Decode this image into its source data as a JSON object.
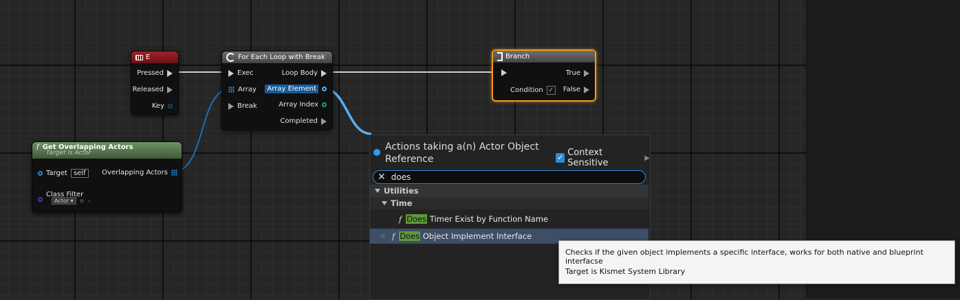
{
  "colors": {
    "graph_bg": "#262626",
    "event_header": "#a3202a",
    "function_header": "#6f9364",
    "selection_outline": "#f29b1d",
    "object_pin": "#2a8cd8",
    "search_highlight": "#5e9a3a"
  },
  "event_node": {
    "title": "E",
    "icon": "keyboard-icon",
    "pins": {
      "pressed": "Pressed",
      "released": "Released",
      "key": "Key"
    }
  },
  "foreach_node": {
    "title": "For Each Loop with Break",
    "icon": "loop-icon",
    "pins": {
      "exec": "Exec",
      "array": "Array",
      "break": "Break",
      "loop_body": "Loop Body",
      "array_element": "Array Element",
      "array_index": "Array Index",
      "completed": "Completed"
    }
  },
  "branch_node": {
    "title": "Branch",
    "icon": "branch-icon",
    "pins": {
      "true": "True",
      "condition": "Condition",
      "false": "False"
    }
  },
  "overlap_node": {
    "title": "Get Overlapping Actors",
    "subtitle": "Target is Actor",
    "icon": "function-icon",
    "pins": {
      "target": "Target",
      "target_value": "self",
      "overlapping_actors": "Overlapping Actors",
      "class_filter": "Class Filter",
      "class_filter_value": "Actor"
    }
  },
  "context_menu": {
    "title": "Actions taking a(n) Actor Object Reference",
    "context_sensitive": "Context Sensitive",
    "search_value": "does",
    "category": "Utilities",
    "subcategory": "Time",
    "items": [
      {
        "highlight": "Does",
        "rest": " Timer Exist by Function Name"
      },
      {
        "highlight": "Does",
        "rest": " Object Implement Interface"
      }
    ]
  },
  "tooltip": {
    "line1": "Checks if the given object implements a specific interface, works for both native and blueprint interfacse",
    "line2": "Target is Kismet System Library"
  }
}
